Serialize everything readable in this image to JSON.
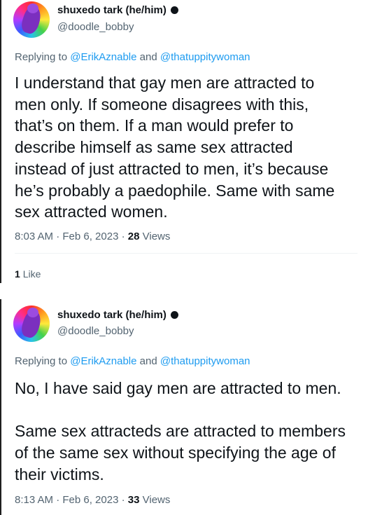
{
  "tweets": [
    {
      "display_name": "shuxedo tark (he/him)",
      "handle": "@doodle_bobby",
      "replying_to_prefix": "Replying to",
      "mention_1": "@ErikAznable",
      "and_word": "and",
      "mention_2": "@thatuppitywoman",
      "text": "I understand that gay men are attracted to\nmen only. If someone disagrees with this,\nthat’s on them. If a man would prefer to\ndescribe himself as same sex attracted\ninstead of just attracted to men, it’s because\nhe’s probably a paedophile. Same with same\nsex attracted women.",
      "time": "8:03 AM · Feb 6, 2023 ·",
      "views_count": "28",
      "views_label": "Views",
      "likes_count": "1",
      "likes_label": "Like"
    },
    {
      "display_name": "shuxedo tark (he/him)",
      "handle": "@doodle_bobby",
      "replying_to_prefix": "Replying to",
      "mention_1": "@ErikAznable",
      "and_word": "and",
      "mention_2": "@thatuppitywoman",
      "text": "No, I have said gay men are attracted to men.\n\nSame sex attracteds are attracted to members\nof the same sex without specifying the age of\ntheir victims.",
      "time": "8:13 AM · Feb 6, 2023 ·",
      "views_count": "33",
      "views_label": "Views"
    }
  ],
  "colors": {
    "link": "#1d9bf0",
    "secondary_text": "#536471",
    "primary_text": "#0f1419"
  },
  "icons": {
    "avatar": "rainbow-avatar",
    "badge": "black-circle-badge"
  }
}
